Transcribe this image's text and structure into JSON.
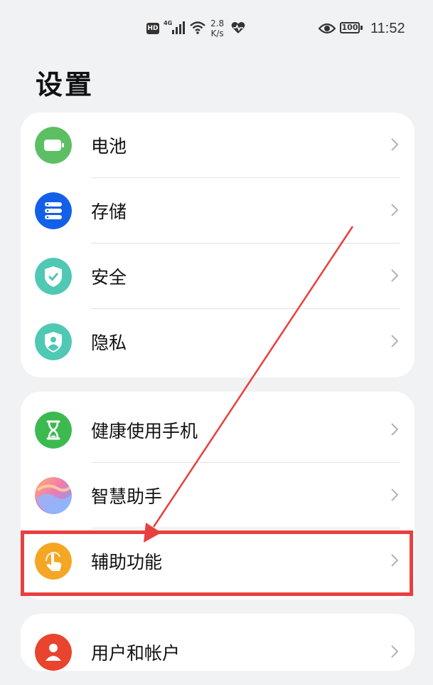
{
  "status_bar": {
    "hd": "HD",
    "network": "4G",
    "speed_value": "2.8",
    "speed_unit": "K/s",
    "battery": "100",
    "time": "11:52"
  },
  "title": "设置",
  "groups": [
    {
      "items": [
        {
          "label": "电池",
          "icon": "battery-icon",
          "color": "#5cbf63"
        },
        {
          "label": "存储",
          "icon": "storage-icon",
          "color": "#1260e8"
        },
        {
          "label": "安全",
          "icon": "shield-check-icon",
          "color": "#4fc8b4"
        },
        {
          "label": "隐私",
          "icon": "privacy-shield-icon",
          "color": "#4fc8b4"
        }
      ]
    },
    {
      "items": [
        {
          "label": "健康使用手机",
          "icon": "hourglass-icon",
          "color": "#3cba50"
        },
        {
          "label": "智慧助手",
          "icon": "assistant-orb-icon",
          "color": "#c08cf0"
        },
        {
          "label": "辅助功能",
          "icon": "hand-tap-icon",
          "color": "#f5a623"
        }
      ]
    },
    {
      "items": [
        {
          "label": "用户和帐户",
          "icon": "user-icon",
          "color": "#e8442e"
        }
      ]
    }
  ],
  "annotation": {
    "highlight_color": "#e8403f",
    "target": "辅助功能"
  }
}
